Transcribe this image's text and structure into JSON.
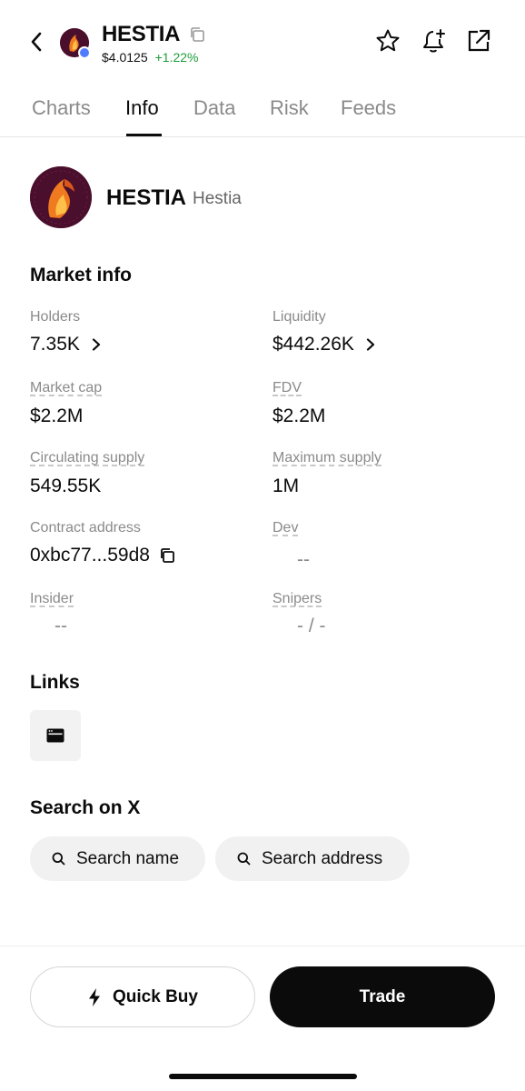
{
  "header": {
    "token_symbol": "HESTIA",
    "price": "$4.0125",
    "price_change": "+1.22%",
    "icons": [
      "back-icon",
      "copy-icon",
      "star-icon",
      "bell-plus-icon",
      "share-external-icon"
    ]
  },
  "tabs": [
    {
      "label": "Charts",
      "active": false
    },
    {
      "label": "Info",
      "active": true
    },
    {
      "label": "Data",
      "active": false
    },
    {
      "label": "Risk",
      "active": false
    },
    {
      "label": "Feeds",
      "active": false
    }
  ],
  "token": {
    "symbol": "HESTIA",
    "name": "Hestia"
  },
  "market_info": {
    "title": "Market info",
    "holders": {
      "label": "Holders",
      "value": "7.35K"
    },
    "liquidity": {
      "label": "Liquidity",
      "value": "$442.26K"
    },
    "market_cap": {
      "label": "Market cap",
      "value": "$2.2M"
    },
    "fdv": {
      "label": "FDV",
      "value": "$2.2M"
    },
    "circulating_supply": {
      "label": "Circulating supply",
      "value": "549.55K"
    },
    "maximum_supply": {
      "label": "Maximum supply",
      "value": "1M"
    },
    "contract_address": {
      "label": "Contract address",
      "value": "0xbc77...59d8"
    },
    "dev": {
      "label": "Dev",
      "value": "--"
    },
    "insider": {
      "label": "Insider",
      "value": "--"
    },
    "snipers": {
      "label": "Snipers",
      "value": "- / -"
    }
  },
  "links": {
    "title": "Links",
    "items": [
      {
        "icon": "website-icon"
      }
    ]
  },
  "search_on_x": {
    "title": "Search on X",
    "search_name": "Search name",
    "search_address": "Search address"
  },
  "actions": {
    "quick_buy": "Quick Buy",
    "trade": "Trade"
  },
  "colors": {
    "positive": "#1f9d3a",
    "primary_button": "#0b0b0b",
    "muted_text": "#8a8a8a"
  }
}
